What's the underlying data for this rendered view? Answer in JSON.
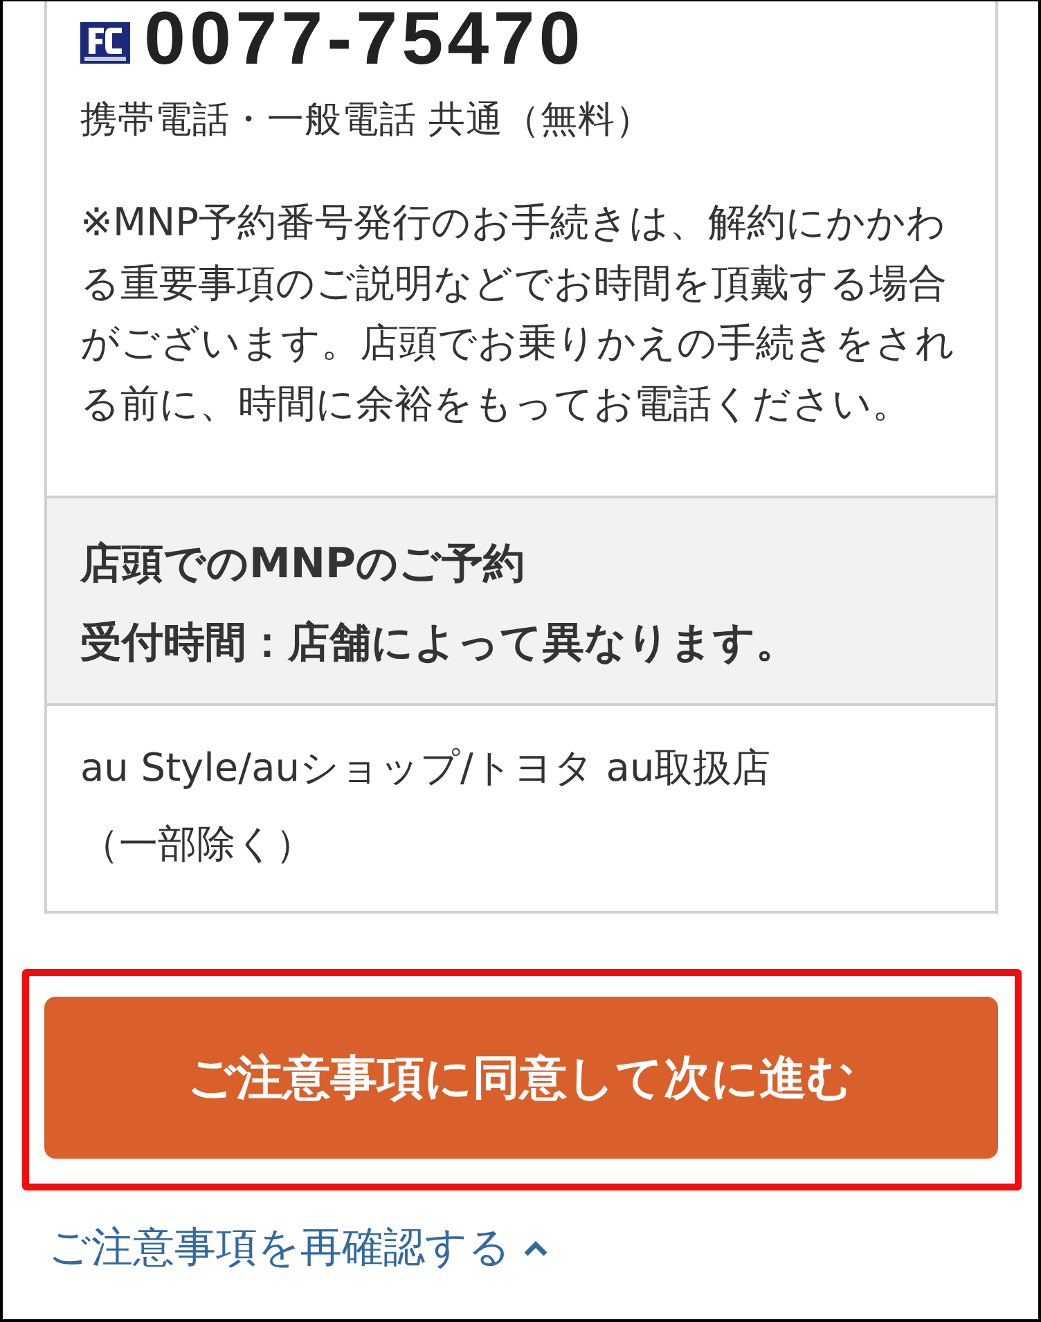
{
  "phone": {
    "number": "0077-75470",
    "note": "携帯電話・一般電話 共通（無料）"
  },
  "notice": "※MNP予約番号発行のお手続きは、解約にかかわる重要事項のご説明などでお時間を頂戴する場合がございます。店頭でお乗りかえの手続きをされる前に、時間に余裕をもってお電話ください。",
  "store_section": {
    "heading": "店頭でのMNPのご予約",
    "hours": "受付時間：店舗によって異なります。",
    "body": "au Style/auショップ/トヨタ au取扱店（一部除く）"
  },
  "primary_button": {
    "label": "ご注意事項に同意して次に進む",
    "highlighted": true
  },
  "review_link": {
    "label": "ご注意事項を再確認する",
    "expanded": true
  }
}
